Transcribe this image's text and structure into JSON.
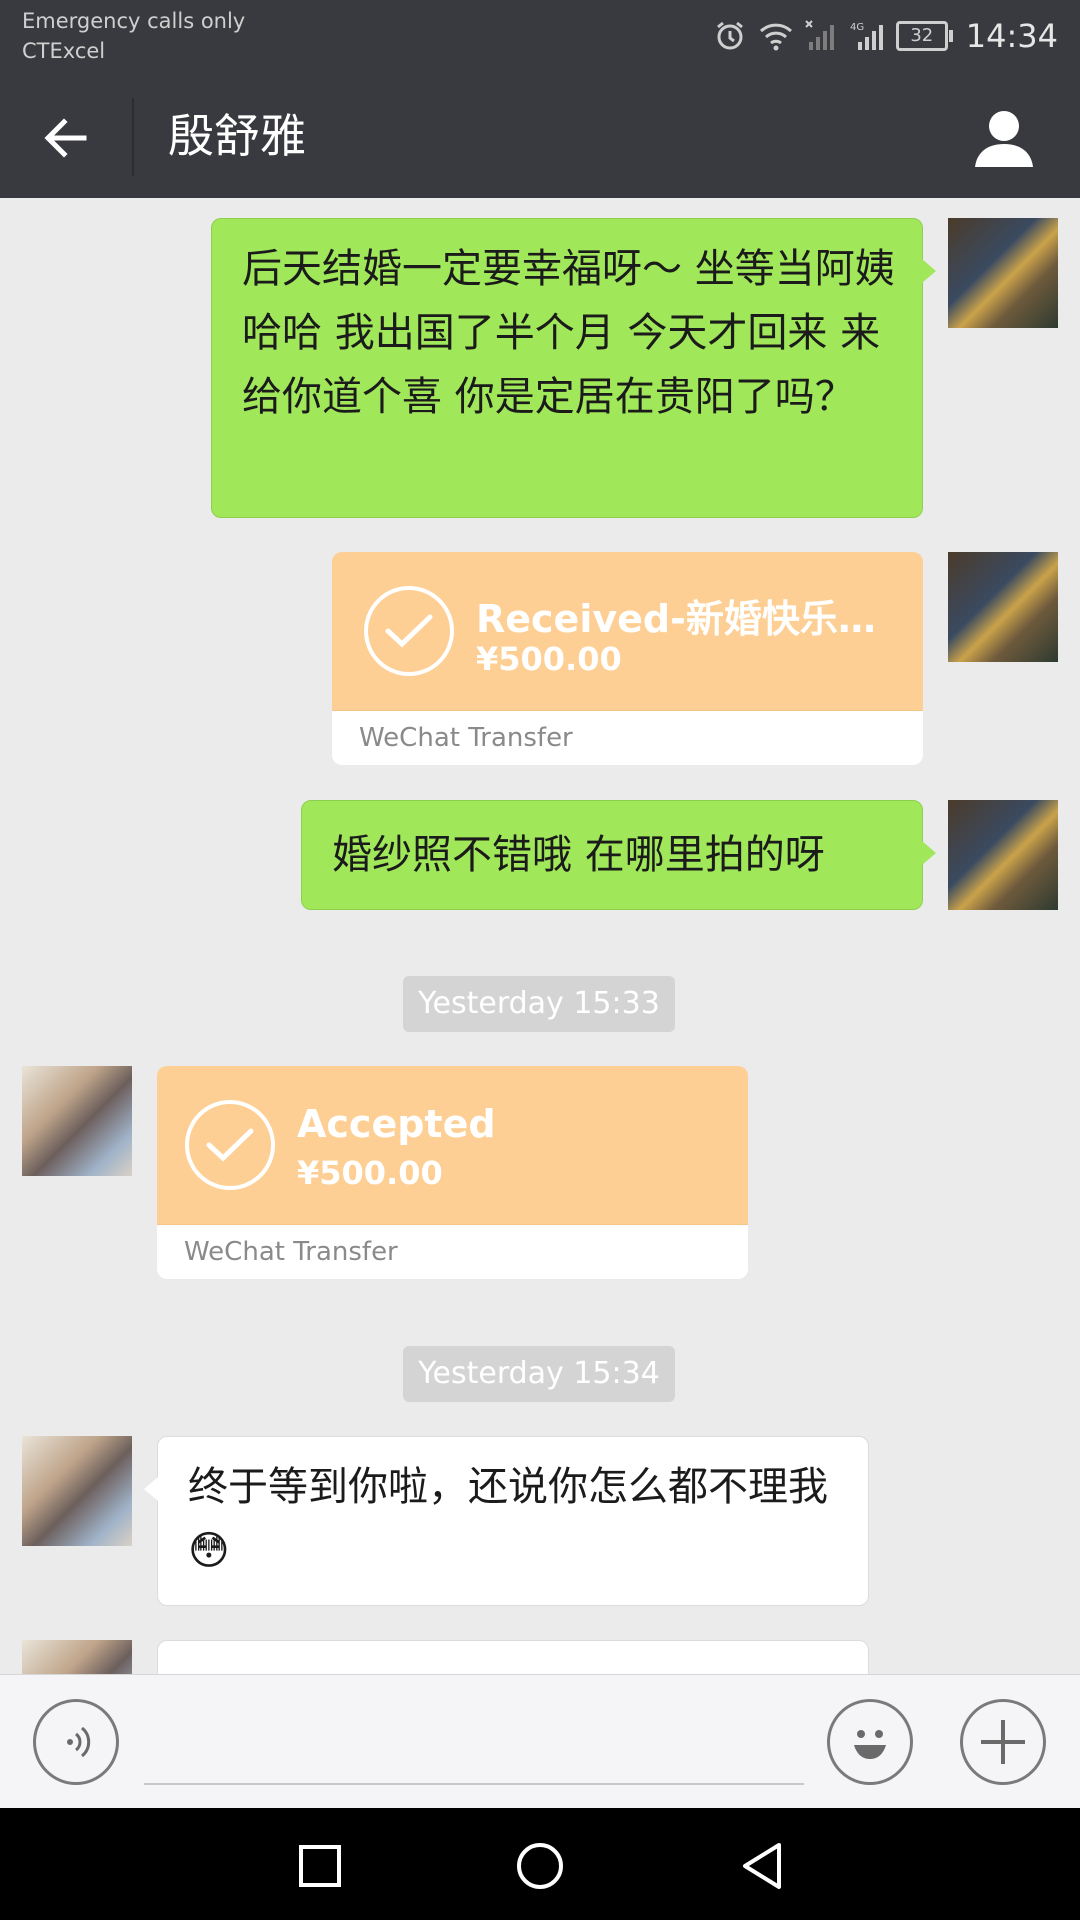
{
  "status_bar": {
    "carrier_line1": "Emergency calls only",
    "carrier_line2": "CTExcel",
    "battery": "32",
    "time": "14:34"
  },
  "header": {
    "title": "殷舒雅"
  },
  "messages": [
    {
      "side": "right",
      "type": "text",
      "text": "后天结婚一定要幸福呀～ 坐等当阿姨  哈哈  我出国了半个月   今天才回来  来给你道个喜  你是定居在贵阳了吗？"
    },
    {
      "side": "right",
      "type": "transfer",
      "title": "Received-新婚快乐…",
      "amount": "¥500.00",
      "footer": "WeChat Transfer"
    },
    {
      "side": "right",
      "type": "text",
      "text": "婚纱照不错哦  在哪里拍的呀"
    },
    {
      "type": "timestamp",
      "text": "Yesterday 15:33"
    },
    {
      "side": "left",
      "type": "transfer",
      "title": "Accepted",
      "amount": "¥500.00",
      "footer": "WeChat Transfer"
    },
    {
      "type": "timestamp",
      "text": "Yesterday 15:34"
    },
    {
      "side": "left",
      "type": "text",
      "text": "终于等到你啦，还说你怎么都不理我😳"
    }
  ],
  "icons": {
    "back": "arrow-left",
    "profile": "person",
    "voice": "voice-wave",
    "emoji": "smiley-face",
    "more": "plus"
  },
  "colors": {
    "header_bg": "#393a3f",
    "sent_bubble": "#a0e75a",
    "transfer": "#fecf94",
    "chat_bg": "#ebebeb"
  }
}
